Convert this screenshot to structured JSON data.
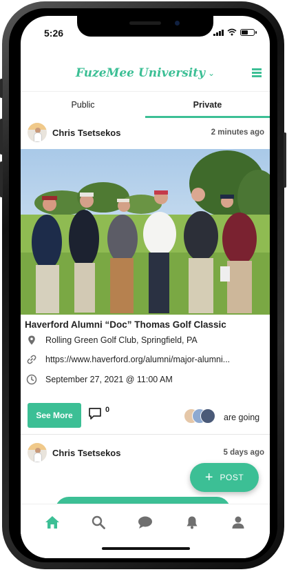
{
  "status_bar": {
    "time": "5:26"
  },
  "app_header": {
    "title": "FuzeMee University",
    "chevron_icon": "chevron-down-icon",
    "menu_icon": "hamburger-menu-icon"
  },
  "tabs": [
    {
      "label": "Public",
      "active": false
    },
    {
      "label": "Private",
      "active": true
    }
  ],
  "posts": [
    {
      "author": "Chris Tsetsekos",
      "time": "2 minutes ago",
      "event_title": "Haverford Alumni “Doc” Thomas Golf Classic",
      "location": "Rolling Green Golf Club, Springfield, PA",
      "link": "https://www.haverford.org/alumni/major-alumni...",
      "datetime": "September 27, 2021 @ 11:00 AM",
      "see_more_label": "See More",
      "comment_count": "0",
      "going_text": "are going"
    },
    {
      "author": "Chris Tsetsekos",
      "time": "5 days ago"
    }
  ],
  "fab": {
    "label": "POST",
    "icon": "plus-icon"
  },
  "bottom_nav": [
    {
      "icon": "home-icon",
      "active": true
    },
    {
      "icon": "search-icon",
      "active": false
    },
    {
      "icon": "chat-icon",
      "active": false
    },
    {
      "icon": "bell-icon",
      "active": false
    },
    {
      "icon": "profile-icon",
      "active": false
    }
  ],
  "colors": {
    "accent": "#3cbf95",
    "text": "#222222",
    "icon_gray": "#6f6f6f"
  }
}
